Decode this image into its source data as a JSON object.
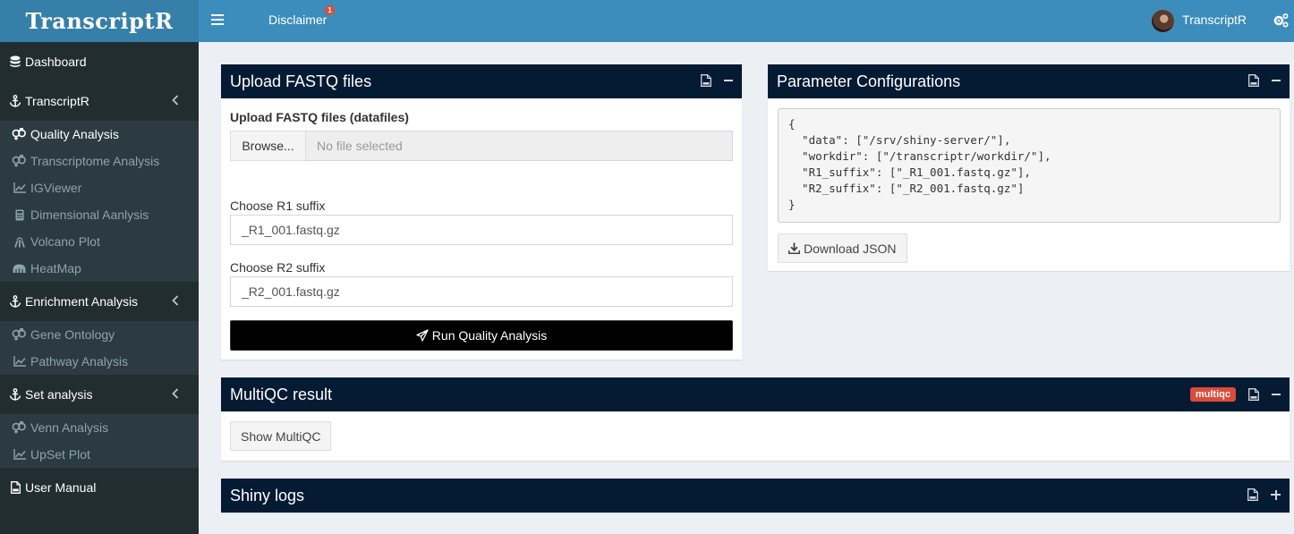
{
  "header": {
    "logo": "TranscriptR",
    "disclaimer_label": "Disclaimer",
    "disclaimer_badge": "1",
    "user_name": "TranscriptR"
  },
  "sidebar": {
    "dashboard": "Dashboard",
    "transcriptr": {
      "label": "TranscriptR",
      "items": [
        "Quality Analysis",
        "Transcriptome Analysis",
        "IGViewer",
        "Dimensional Aanlysis",
        "Volcano Plot",
        "HeatMap"
      ]
    },
    "enrichment": {
      "label": "Enrichment Analysis",
      "items": [
        "Gene Ontology",
        "Pathway Analysis"
      ]
    },
    "set_analysis": {
      "label": "Set analysis",
      "items": [
        "Venn Analysis",
        "UpSet Plot"
      ]
    },
    "user_manual": "User Manual"
  },
  "upload_box": {
    "title": "Upload FASTQ files",
    "file_label": "Upload FASTQ files (datafiles)",
    "browse_label": "Browse...",
    "file_placeholder": "No file selected",
    "r1_label": "Choose R1 suffix",
    "r1_value": "_R1_001.fastq.gz",
    "r2_label": "Choose R2 suffix",
    "r2_value": "_R2_001.fastq.gz",
    "run_label": "Run Quality Analysis"
  },
  "param_box": {
    "title": "Parameter Configurations",
    "json_text": "{\n  \"data\": [\"/srv/shiny-server/\"],\n  \"workdir\": [\"/transcriptr/workdir/\"],\n  \"R1_suffix\": [\"_R1_001.fastq.gz\"],\n  \"R2_suffix\": [\"_R2_001.fastq.gz\"]\n}",
    "download_label": "Download JSON"
  },
  "multiqc_box": {
    "title": "MultiQC result",
    "badge": "multiqc",
    "show_label": "Show MultiQC"
  },
  "logs_box": {
    "title": "Shiny logs"
  },
  "colors": {
    "header": "#3c8dbc",
    "logo": "#367fa9",
    "sidebar": "#222d32",
    "box_header": "#051a33",
    "badge": "#dd4b39"
  }
}
